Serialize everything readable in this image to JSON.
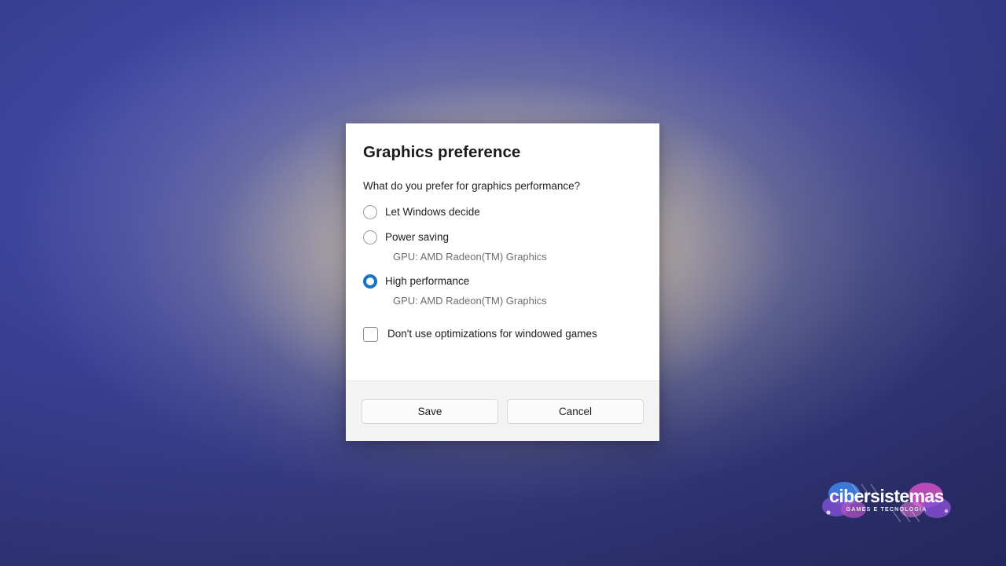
{
  "desktop": {
    "background_colors": {
      "blue_top_left": "#4049a6",
      "blue_bottom_left": "#2d3070",
      "warm_center_glow": "#eee4c4",
      "navy_deep": "#2a2d68"
    }
  },
  "dialog": {
    "title": "Graphics preference",
    "subtitle": "What do you prefer for graphics performance?",
    "radio_options": [
      {
        "label": "Let Windows decide",
        "selected": false,
        "gpu": null
      },
      {
        "label": "Power saving",
        "selected": false,
        "gpu": "GPU: AMD Radeon(TM) Graphics"
      },
      {
        "label": "High performance",
        "selected": true,
        "gpu": "GPU: AMD Radeon(TM) Graphics"
      }
    ],
    "checkbox": {
      "label": "Don't use optimizations for windowed games",
      "checked": false
    },
    "footer": {
      "save_label": "Save",
      "cancel_label": "Cancel"
    },
    "accent_color": "#1273c7",
    "body_background": "#ffffff",
    "footer_background": "#f3f3f3"
  },
  "watermark": {
    "brand": "cibersistemas",
    "tagline": "GAMES E TECNOLOGIA",
    "brand_color": "#ffffff",
    "blob_blue": "#3f7fe0",
    "blob_pink": "#e262c8"
  }
}
